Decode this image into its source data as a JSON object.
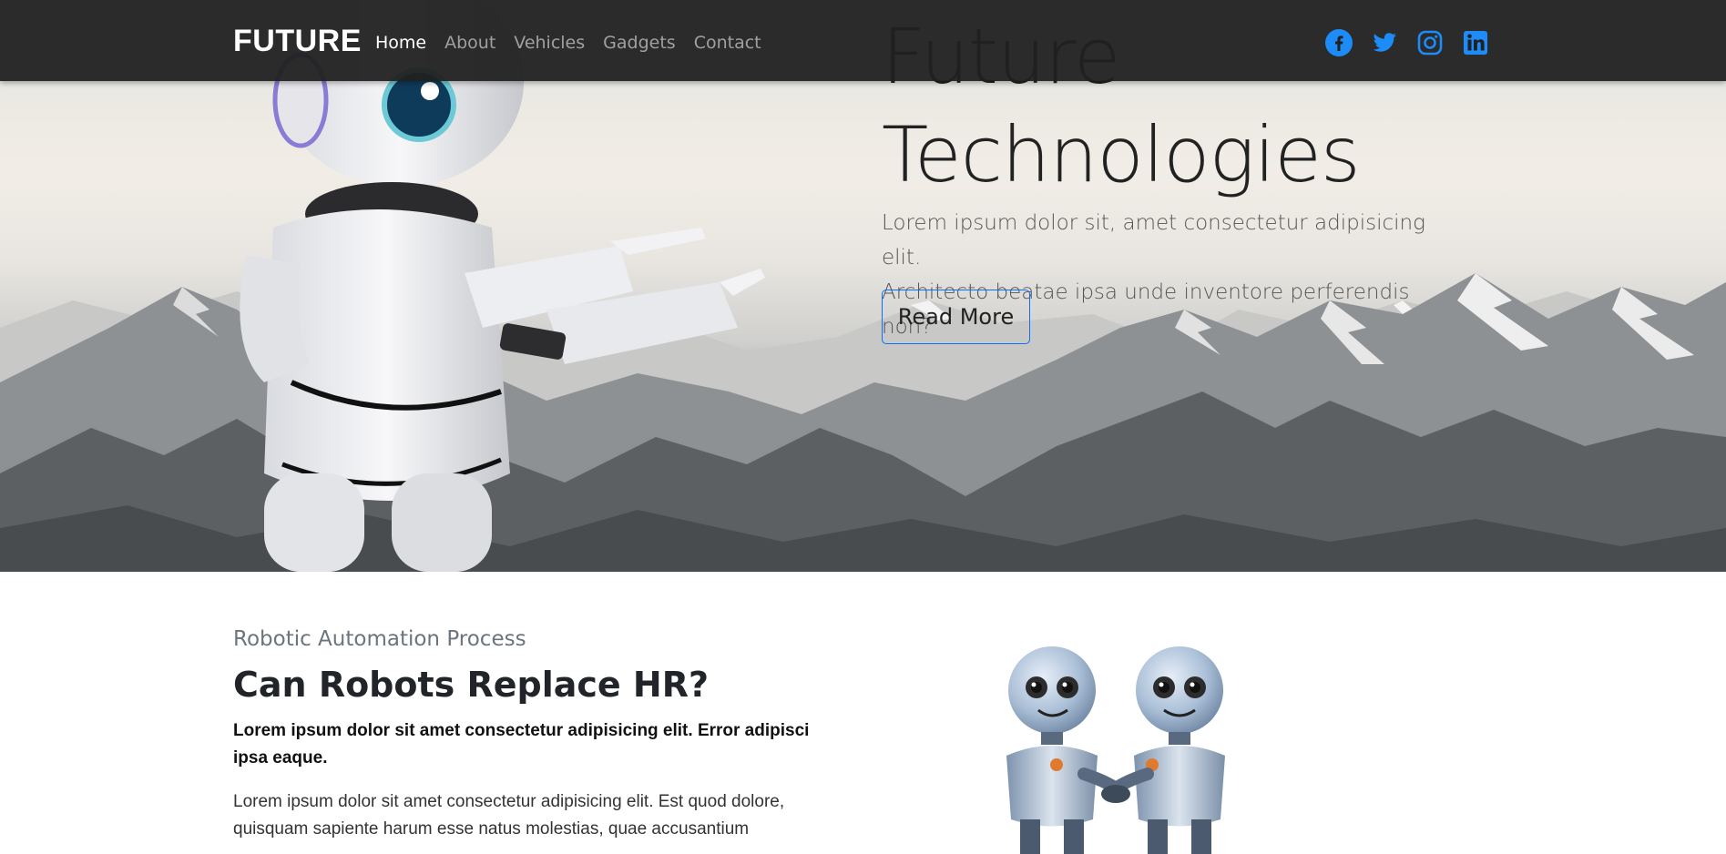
{
  "nav": {
    "brand": "FUTURE",
    "links": [
      {
        "label": "Home",
        "active": true
      },
      {
        "label": "About",
        "active": false
      },
      {
        "label": "Vehicles",
        "active": false
      },
      {
        "label": "Gadgets",
        "active": false
      },
      {
        "label": "Contact",
        "active": false
      }
    ],
    "social": [
      "facebook-icon",
      "twitter-icon",
      "instagram-icon",
      "linkedin-icon"
    ],
    "social_color": "#1d8cf8"
  },
  "hero": {
    "title_line1": "Future",
    "title_line2": "Technologies",
    "lead_line1": "Lorem ipsum dolor sit, amet consectetur adipisicing elit.",
    "lead_line2": "Architecto beatae ipsa unde inventore perferendis non?",
    "button_label": "Read More",
    "button_border_color": "#0d6efd"
  },
  "section": {
    "eyebrow": "Robotic Automation Process",
    "title": "Can Robots Replace HR?",
    "bold_line1": "Lorem ipsum dolor sit amet consectetur adipisicing elit. Error adipisci",
    "bold_line2": "ipsa eaque.",
    "body_line1": "Lorem ipsum dolor sit amet consectetur adipisicing elit. Est quod dolore,",
    "body_line2": "quisquam sapiente harum esse natus molestias, quae accusantium"
  }
}
